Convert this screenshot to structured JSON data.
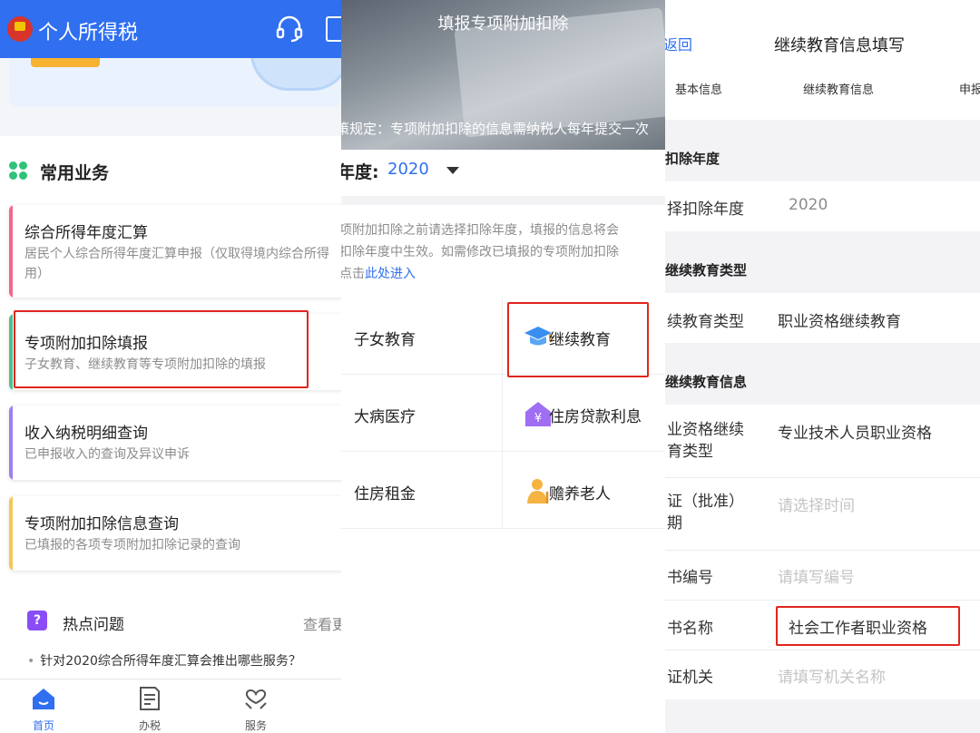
{
  "panel1": {
    "app_title": "个人所得税",
    "section_title": "常用业务",
    "cards": [
      {
        "title": "综合所得年度汇算",
        "subtitle": "居民个人综合所得年度汇算申报（仅取得境内综合所得用）",
        "accent": "#f06a8c"
      },
      {
        "title": "专项附加扣除填报",
        "subtitle": "子女教育、继续教育等专项附加扣除的填报",
        "accent": "#4fc08d"
      },
      {
        "title": "收入纳税明细查询",
        "subtitle": "已申报收入的查询及异议申诉",
        "accent": "#9f7ef2"
      },
      {
        "title": "专项附加扣除信息查询",
        "subtitle": "已填报的各项专项附加扣除记录的查询",
        "accent": "#f6c65a"
      }
    ],
    "hot": {
      "icon_text": "?",
      "title": "热点问题",
      "more": "查看更",
      "question": "针对2020综合所得年度汇算会推出哪些服务？"
    },
    "tabs": [
      {
        "label": "首页",
        "icon": "home-icon"
      },
      {
        "label": "办税",
        "icon": "tax-form-icon"
      },
      {
        "label": "服务",
        "icon": "heart-hands-icon"
      }
    ]
  },
  "panel2": {
    "hero_title": "填报专项附加扣除",
    "hero_note": "策规定：专项附加扣除的信息需纳税人每年提交一次",
    "year_label": "年度:",
    "year_value": "2020",
    "desc_line1": "项附加扣除之前请选择扣除年度，填报的信息将会",
    "desc_line2": "扣除年度中生效。如需修改已填报的专项附加扣除",
    "desc_prefix": "点击",
    "desc_link": "此处进入",
    "items": [
      {
        "label": "子女教育",
        "icon": ""
      },
      {
        "label": "继续教育",
        "icon": "graduation-cap-icon"
      },
      {
        "label": "大病医疗",
        "icon": ""
      },
      {
        "label": "住房贷款利息",
        "icon": "house-yuan-icon"
      },
      {
        "label": "住房租金",
        "icon": ""
      },
      {
        "label": "赡养老人",
        "icon": "elderly-person-icon"
      }
    ]
  },
  "panel3": {
    "back": "返回",
    "title": "继续教育信息填写",
    "steps": [
      "基本信息",
      "继续教育信息",
      "申报"
    ],
    "sec_year": "扣除年度",
    "row_year_label": "择扣除年度",
    "row_year_value": "2020",
    "sec_type": "继续教育类型",
    "row_type_label": "续教育类型",
    "row_type_value": "职业资格继续教育",
    "sec_info": "继续教育信息",
    "row_qual_label_1": "业资格继续",
    "row_qual_label_2": "育类型",
    "row_qual_value": "专业技术人员职业资格",
    "row_date_label_1": "证（批准）",
    "row_date_label_2": "期",
    "row_date_placeholder": "请选择时间",
    "row_no_label": "书编号",
    "row_no_placeholder": "请填写编号",
    "row_name_label": "书名称",
    "row_name_value": "社会工作者职业资格",
    "row_org_label": "证机关",
    "row_org_placeholder": "请填写机关名称"
  },
  "colors": {
    "primary": "#2f6ff0",
    "highlight": "#e0251e"
  }
}
